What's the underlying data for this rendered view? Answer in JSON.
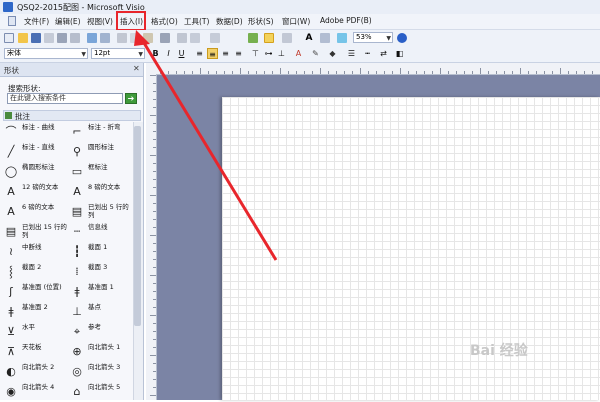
{
  "window": {
    "title": "QSQ2-2015配图 - Microsoft Visio"
  },
  "menu": [
    {
      "label": "文件(F)"
    },
    {
      "label": "编辑(E)"
    },
    {
      "label": "视图(V)"
    },
    {
      "label": "插入(I)"
    },
    {
      "label": "格式(O)"
    },
    {
      "label": "工具(T)"
    },
    {
      "label": "数据(D)"
    },
    {
      "label": "形状(S)"
    },
    {
      "label": "窗口(W)"
    },
    {
      "label": "Adobe PDF(B)"
    }
  ],
  "toolbar": {
    "zoom": "53%",
    "font_name": "宋体",
    "font_size": "12pt"
  },
  "shapes_pane": {
    "title": "形状",
    "search_label": "搜索形状:",
    "search_placeholder": "在此键入搜索条件",
    "stencil_title": "批注",
    "items": [
      {
        "label": "标注 - 曲线",
        "icon": "callout-curve-icon",
        "glyph": "⌒"
      },
      {
        "label": "标注 - 折弯",
        "icon": "callout-bend-icon",
        "glyph": "⌐"
      },
      {
        "label": "标注 - 直线",
        "icon": "callout-line-icon",
        "glyph": "╱"
      },
      {
        "label": "圆形标注",
        "icon": "circle-callout-icon",
        "glyph": "⚲"
      },
      {
        "label": "椭圆形标注",
        "icon": "ellipse-callout-icon",
        "glyph": "◯"
      },
      {
        "label": "框标注",
        "icon": "box-callout-icon",
        "glyph": "▭"
      },
      {
        "label": "12 磅的文本",
        "icon": "text-12-icon",
        "glyph": "A"
      },
      {
        "label": "8 磅的文本",
        "icon": "text-8-icon",
        "glyph": "A"
      },
      {
        "label": "6 磅的文本",
        "icon": "text-6-icon",
        "glyph": "A"
      },
      {
        "label": "已划出 5 行的列",
        "icon": "lined-5-icon",
        "glyph": "▤"
      },
      {
        "label": "已划出 15 行的列",
        "icon": "lined-15-icon",
        "glyph": "▤"
      },
      {
        "label": "信息线",
        "icon": "info-line-icon",
        "glyph": "┄"
      },
      {
        "label": "中断线",
        "icon": "break-line-icon",
        "glyph": "≀"
      },
      {
        "label": "截面 1",
        "icon": "section-1-icon",
        "glyph": "┇"
      },
      {
        "label": "截面 2",
        "icon": "section-2-icon",
        "glyph": "⸾"
      },
      {
        "label": "截面 3",
        "icon": "section-3-icon",
        "glyph": "⁞"
      },
      {
        "label": "基准面 (位置)",
        "icon": "datum-position-icon",
        "glyph": "ʃ"
      },
      {
        "label": "基准面 1",
        "icon": "datum-1-icon",
        "glyph": "ǂ"
      },
      {
        "label": "基准面 2",
        "icon": "datum-2-icon",
        "glyph": "ǂ"
      },
      {
        "label": "基点",
        "icon": "base-point-icon",
        "glyph": "⊥"
      },
      {
        "label": "水平",
        "icon": "horizontal-icon",
        "glyph": "⊻"
      },
      {
        "label": "参考",
        "icon": "reference-icon",
        "glyph": "⌖"
      },
      {
        "label": "天花板",
        "icon": "ceiling-icon",
        "glyph": "⊼"
      },
      {
        "label": "向北箭头 1",
        "icon": "north-arrow-1-icon",
        "glyph": "⊕"
      },
      {
        "label": "向北箭头 2",
        "icon": "north-arrow-2-icon",
        "glyph": "◐"
      },
      {
        "label": "向北箭头 3",
        "icon": "north-arrow-3-icon",
        "glyph": "◎"
      },
      {
        "label": "向北箭头 4",
        "icon": "north-arrow-4-icon",
        "glyph": "◉"
      },
      {
        "label": "向北箭头 5",
        "icon": "north-arrow-5-icon",
        "glyph": "⌂"
      }
    ]
  },
  "annotation": {
    "highlight_color": "#e8262c",
    "arrow_color": "#e8262c"
  },
  "watermark": "Bai 经验"
}
